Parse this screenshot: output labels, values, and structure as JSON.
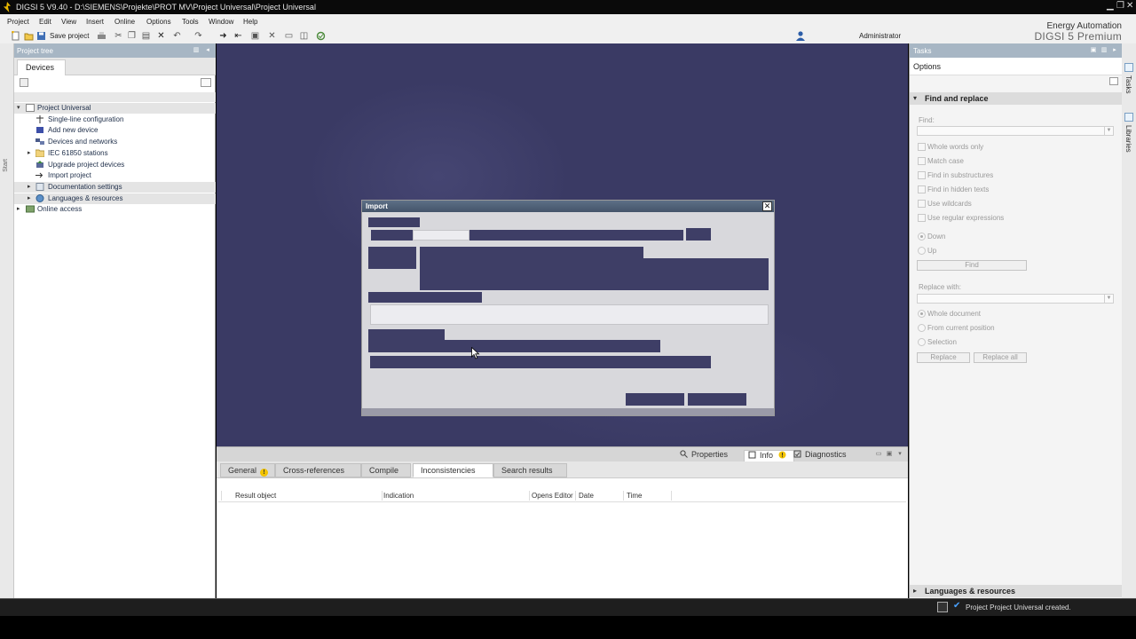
{
  "window": {
    "title": "DIGSI 5 V9.40 - D:\\SIEMENS\\Projekte\\PROT MV\\Project Universal\\Project Universal",
    "minimize": "▁",
    "maximize": "❐",
    "close": "✕"
  },
  "menu": [
    "Project",
    "Edit",
    "View",
    "Insert",
    "Online",
    "Options",
    "Tools",
    "Window",
    "Help"
  ],
  "toolbar": {
    "save_label": "Save project",
    "user": "Administrator"
  },
  "brand": {
    "line1": "Energy Automation",
    "line2": "DIGSI 5 Premium"
  },
  "start_tab": "Start",
  "project_tree": {
    "header": "Project tree",
    "tab": "Devices",
    "nodes": [
      {
        "label": "Project Universal",
        "level": 0,
        "expander": "▾",
        "icon": "project-icon"
      },
      {
        "label": "Single-line configuration",
        "level": 1,
        "expander": "",
        "icon": "single-line-icon"
      },
      {
        "label": "Add new device",
        "level": 1,
        "expander": "",
        "icon": "add-device-icon"
      },
      {
        "label": "Devices and networks",
        "level": 1,
        "expander": "",
        "icon": "network-icon"
      },
      {
        "label": "IEC 61850 stations",
        "level": 1,
        "expander": "▸",
        "icon": "folder-icon"
      },
      {
        "label": "Upgrade project devices",
        "level": 1,
        "expander": "",
        "icon": "upgrade-icon"
      },
      {
        "label": "Import project",
        "level": 1,
        "expander": "",
        "icon": "import-icon"
      },
      {
        "label": "Documentation settings",
        "level": 1,
        "expander": "▸",
        "icon": "documentation-icon"
      },
      {
        "label": "Languages & resources",
        "level": 1,
        "expander": "▸",
        "icon": "languages-icon"
      },
      {
        "label": "Online access",
        "level": 0,
        "expander": "▸",
        "icon": "online-access-icon"
      }
    ]
  },
  "dialog": {
    "title": "Import",
    "close": "✕"
  },
  "inspector": {
    "properties": "Properties",
    "info": "Info",
    "diagnostics": "Diagnostics",
    "tabs": [
      "General",
      "Cross-references",
      "Compile",
      "Inconsistencies",
      "Search results"
    ],
    "selected_tab": "Inconsistencies",
    "columns": [
      "Result object",
      "Indication",
      "Opens Editor",
      "Date",
      "Time"
    ]
  },
  "tasks": {
    "header": "Tasks",
    "options": "Options",
    "section": "Find and replace",
    "find_label": "Find:",
    "checkboxes": [
      "Whole words only",
      "Match case",
      "Find in substructures",
      "Find in hidden texts",
      "Use wildcards",
      "Use regular expressions"
    ],
    "direction": [
      "Down",
      "Up"
    ],
    "find_button": "Find",
    "replace_label": "Replace with:",
    "scope": [
      "Whole document",
      "From current position",
      "Selection"
    ],
    "replace_button": "Replace",
    "replace_all_button": "Replace all",
    "bottom_section": "Languages & resources"
  },
  "side_tabs": [
    "Tasks",
    "Libraries"
  ],
  "status": {
    "message": "Project Project Universal created."
  },
  "colors": {
    "workspace": "#3a3a64",
    "panel_header": "#a7b6c4",
    "dialog_blocks": "#3e3e66",
    "status_ok": "#4aa3ff"
  }
}
